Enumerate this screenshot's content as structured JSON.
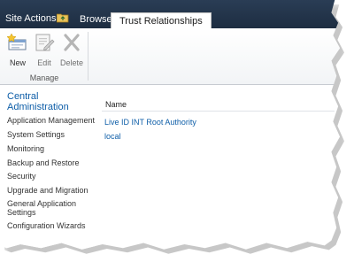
{
  "topbar": {
    "site_actions_label": "Site Actions",
    "tabs": [
      {
        "label": "Browse"
      },
      {
        "label": "Trust Relationships"
      }
    ]
  },
  "ribbon": {
    "buttons": [
      {
        "label": "New",
        "icon": "new-trust-icon"
      },
      {
        "label": "Edit",
        "icon": "edit-icon"
      },
      {
        "label": "Delete",
        "icon": "delete-icon"
      }
    ],
    "group_label": "Manage"
  },
  "quick_launch": {
    "heading": "Central Administration",
    "items": [
      {
        "label": "Application Management"
      },
      {
        "label": "System Settings"
      },
      {
        "label": "Monitoring"
      },
      {
        "label": "Backup and Restore"
      },
      {
        "label": "Security"
      },
      {
        "label": "Upgrade and Migration"
      },
      {
        "label": "General Application Settings"
      },
      {
        "label": "Configuration Wizards"
      }
    ]
  },
  "list": {
    "column_header": "Name",
    "rows": [
      {
        "name": "Live ID INT Root Authority"
      },
      {
        "name": "local"
      }
    ]
  },
  "colors": {
    "topbar": "#1d2d41",
    "link": "#0e5ea8"
  }
}
